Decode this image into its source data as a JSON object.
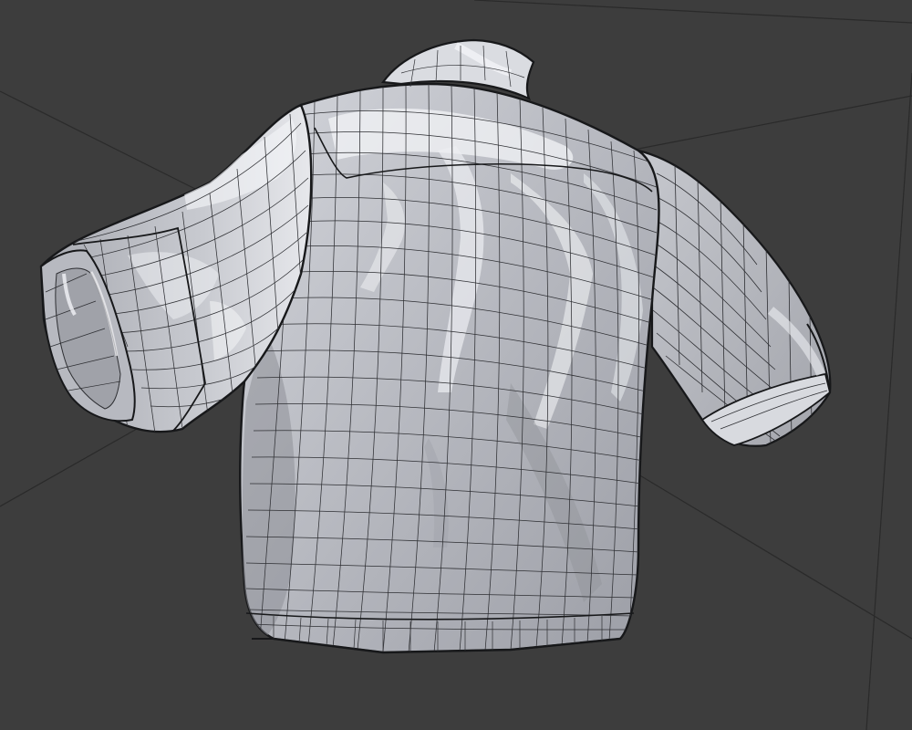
{
  "viewport": {
    "background_color": "#3d3d3d",
    "grid_line_color": "#2a2a2a",
    "mesh_fill_color": "#c2c4cb",
    "mesh_shadow_color": "#8e9097",
    "mesh_highlight_color": "#f3f4f7",
    "wire_color": "#2e2f33",
    "outline_color": "#17181a"
  },
  "object": {
    "icon": "shirt-mesh-icon"
  }
}
